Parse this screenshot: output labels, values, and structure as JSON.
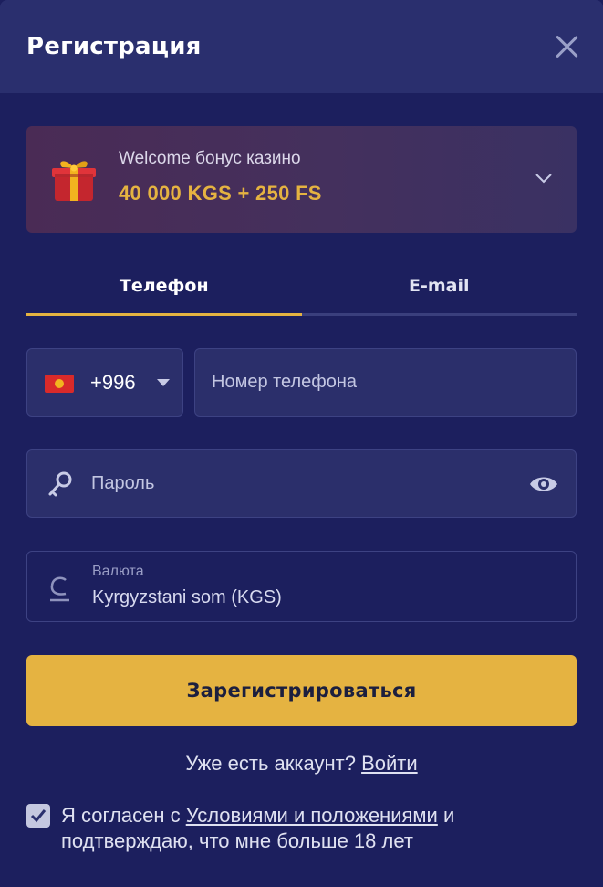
{
  "header": {
    "title": "Регистрация"
  },
  "bonus": {
    "label": "Welcome бонус казино",
    "amount": "40 000 KGS + 250 FS"
  },
  "tabs": [
    {
      "label": "Телефон",
      "active": true
    },
    {
      "label": "E-mail",
      "active": false
    }
  ],
  "phone": {
    "country_code": "+996",
    "placeholder": "Номер телефона",
    "value": ""
  },
  "password": {
    "placeholder": "Пароль",
    "value": ""
  },
  "currency": {
    "label": "Валюта",
    "value": "Kyrgyzstani som (KGS)"
  },
  "submit": {
    "label": "Зарегистрироваться"
  },
  "login": {
    "prompt": "Уже есть аккаунт?",
    "link": "Войти"
  },
  "agreement": {
    "checked": true,
    "prefix": "Я согласен с",
    "link": "Условиями и положениями",
    "suffix": "и подтверждаю, что мне больше 18 лет"
  },
  "colors": {
    "background": "#1c1f5e",
    "header": "#2a2f6e",
    "accent": "#e5b341",
    "field": "#2b2f6b"
  },
  "icons": [
    "close-icon",
    "gift-icon",
    "chevron-down-icon",
    "kyrgyzstan-flag-icon",
    "caret-down-icon",
    "key-icon",
    "eye-icon",
    "currency-icon",
    "checkmark-icon"
  ]
}
